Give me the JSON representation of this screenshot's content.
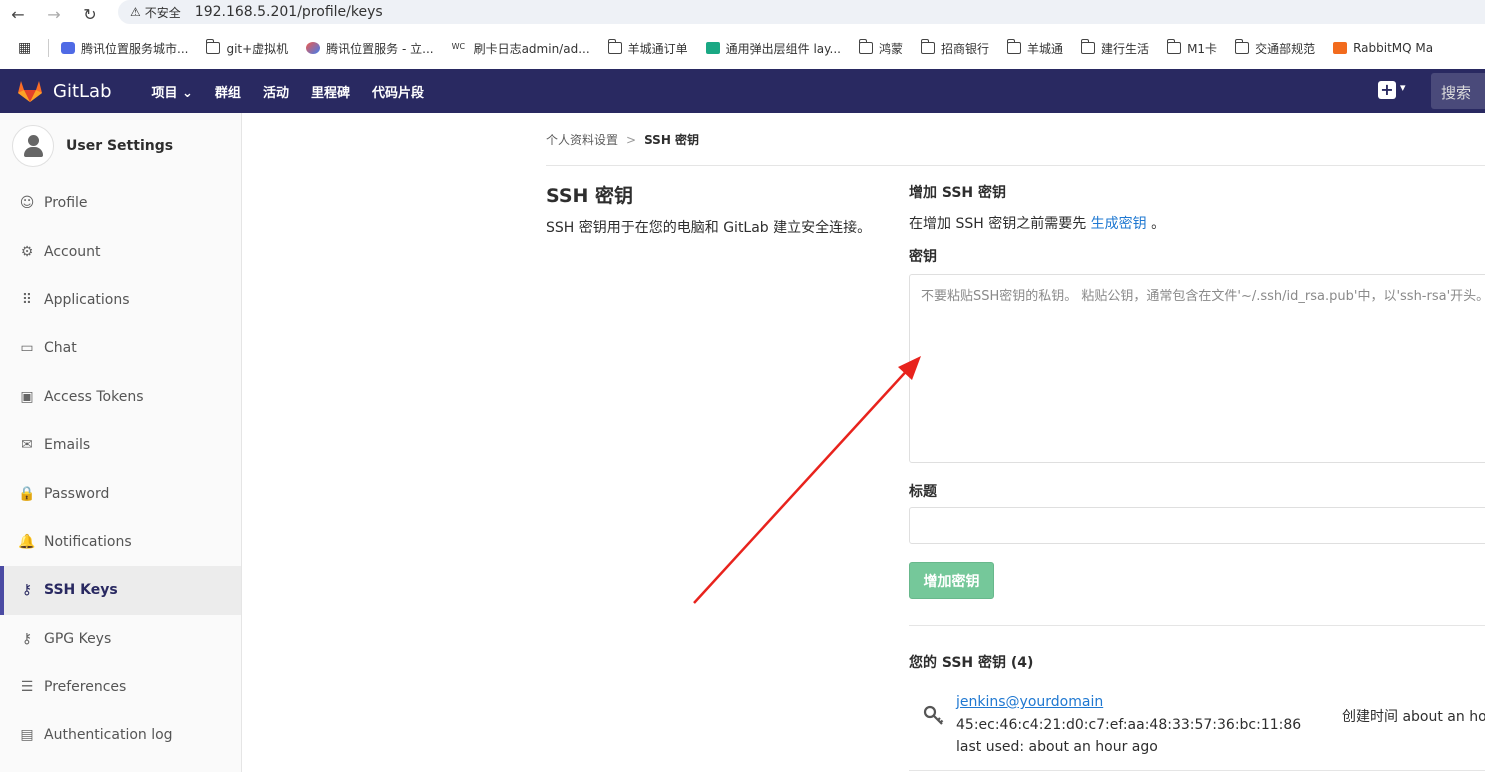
{
  "browser": {
    "insecure_label": "不安全",
    "url": "192.168.5.201/profile/keys",
    "bookmarks": [
      {
        "label": "腾讯位置服务城市...",
        "icon": "link-icon"
      },
      {
        "label": "git+虚拟机",
        "icon": "folder-icon"
      },
      {
        "label": "腾讯位置服务 - 立...",
        "icon": "bird-icon"
      },
      {
        "label": "刷卡日志admin/ad...",
        "icon": "wc-icon"
      },
      {
        "label": "羊城通订单",
        "icon": "folder-icon"
      },
      {
        "label": "通用弹出层组件 lay...",
        "icon": "layui-icon"
      },
      {
        "label": "鸿蒙",
        "icon": "folder-icon"
      },
      {
        "label": "招商银行",
        "icon": "folder-icon"
      },
      {
        "label": "羊城通",
        "icon": "folder-icon"
      },
      {
        "label": "建行生活",
        "icon": "folder-icon"
      },
      {
        "label": "M1卡",
        "icon": "folder-icon"
      },
      {
        "label": "交通部规范",
        "icon": "folder-icon"
      },
      {
        "label": "RabbitMQ Ma",
        "icon": "rabbitmq-icon"
      }
    ]
  },
  "header": {
    "brand": "GitLab",
    "nav": [
      "项目 ⌄",
      "群组",
      "活动",
      "里程碑",
      "代码片段"
    ],
    "search_label": "搜索"
  },
  "sidebar": {
    "title": "User Settings",
    "items": [
      {
        "label": "Profile",
        "icon": "profile-icon",
        "glyph": "☺"
      },
      {
        "label": "Account",
        "icon": "account-icon",
        "glyph": "⚙"
      },
      {
        "label": "Applications",
        "icon": "applications-icon",
        "glyph": "⠿"
      },
      {
        "label": "Chat",
        "icon": "chat-icon",
        "glyph": "▭"
      },
      {
        "label": "Access Tokens",
        "icon": "access-tokens-icon",
        "glyph": "▣"
      },
      {
        "label": "Emails",
        "icon": "emails-icon",
        "glyph": "✉"
      },
      {
        "label": "Password",
        "icon": "password-icon",
        "glyph": "🔒"
      },
      {
        "label": "Notifications",
        "icon": "notifications-icon",
        "glyph": "🔔"
      },
      {
        "label": "SSH Keys",
        "icon": "ssh-keys-icon",
        "glyph": "⚷",
        "active": true
      },
      {
        "label": "GPG Keys",
        "icon": "gpg-keys-icon",
        "glyph": "⚷"
      },
      {
        "label": "Preferences",
        "icon": "preferences-icon",
        "glyph": "☰"
      },
      {
        "label": "Authentication log",
        "icon": "authentication-log-icon",
        "glyph": "▤"
      }
    ]
  },
  "breadcrumb": {
    "parent": "个人资料设置",
    "separator": ">",
    "current": "SSH 密钥"
  },
  "intro": {
    "title": "SSH 密钥",
    "description": "SSH 密钥用于在您的电脑和 GitLab 建立安全连接。"
  },
  "form": {
    "heading": "增加 SSH 密钥",
    "note_prefix": "在增加 SSH 密钥之前需要先",
    "note_link": "生成密钥",
    "note_suffix": "。",
    "key_label": "密钥",
    "key_placeholder": "不要粘贴SSH密钥的私钥。 粘贴公钥，通常包含在文件'~/.ssh/id_rsa.pub'中，以'ssh-rsa'开头。",
    "title_label": "标题",
    "title_value": "",
    "submit_label": "增加密钥"
  },
  "keys": {
    "heading": "您的 SSH 密钥 (4)",
    "items": [
      {
        "name": "jenkins@yourdomain",
        "fingerprint": "45:ec:46:c4:21:d0:c7:ef:aa:48:33:57:36:bc:11:86",
        "last_used": "last used: about an hour ago",
        "created": "创建时间 about an ho"
      }
    ]
  },
  "colors": {
    "header_bg": "#292961",
    "link": "#1f78d1",
    "button_bg": "#75c89a",
    "arrow": "#e8231d"
  }
}
